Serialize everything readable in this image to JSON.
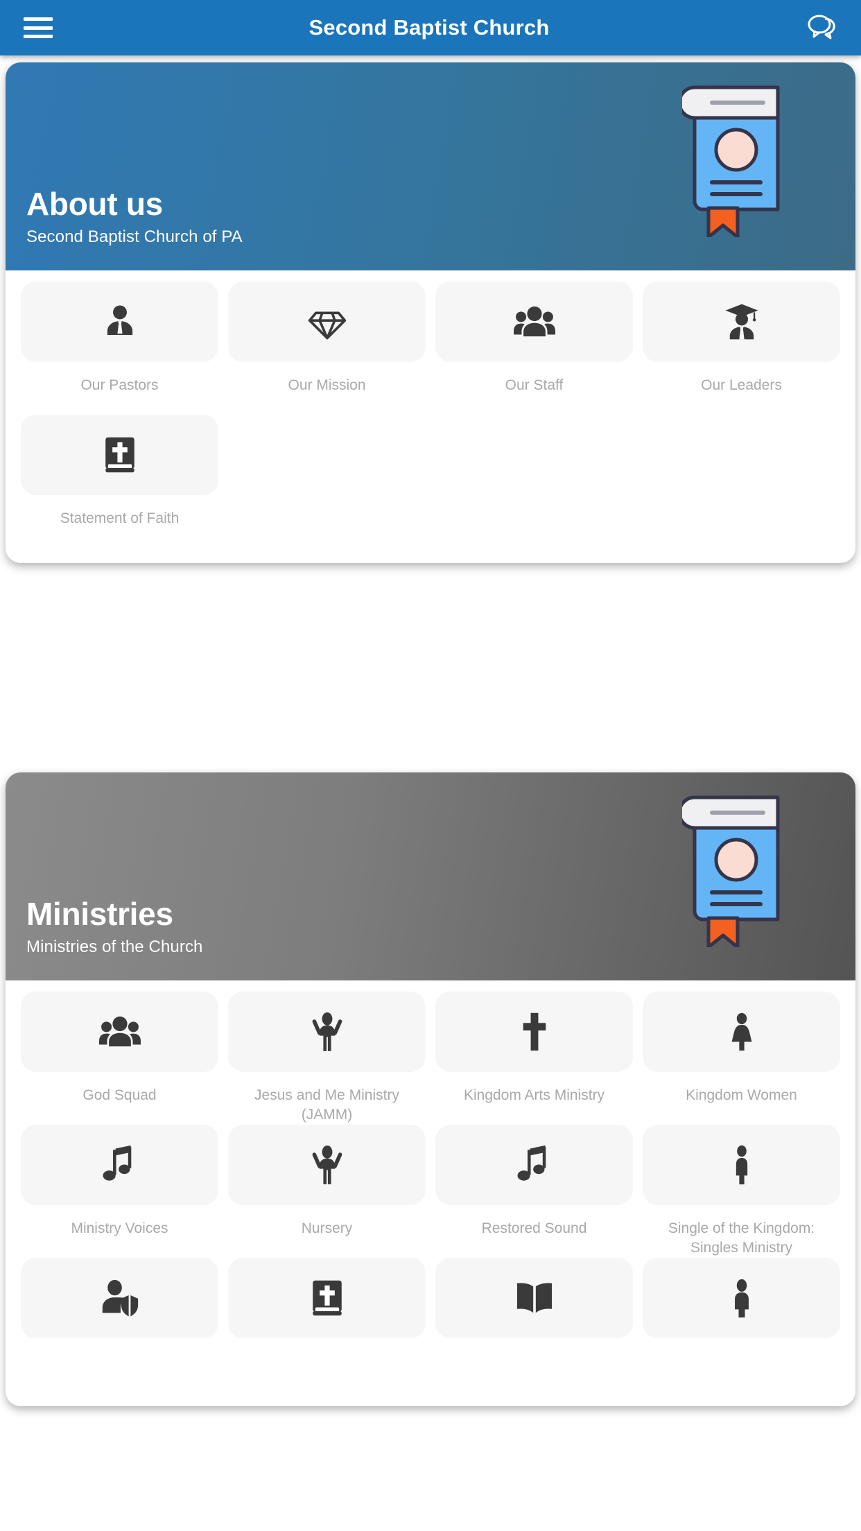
{
  "appbar": {
    "menu_icon": "hamburger-menu-icon",
    "title": "Second Baptist Church",
    "chat_icon": "chat-bubbles-icon"
  },
  "sections": [
    {
      "id": "about",
      "theme": "blue",
      "title": "About us",
      "subtitle": "Second Baptist Church of PA",
      "art_icon": "book-illustration",
      "tiles": [
        {
          "label": "Our Pastors",
          "icon": "person-in-tie-icon"
        },
        {
          "label": "Our Mission",
          "icon": "diamond-gem-icon"
        },
        {
          "label": "Our Staff",
          "icon": "people-group-icon"
        },
        {
          "label": "Our Leaders",
          "icon": "graduate-person-icon"
        },
        {
          "label": "Statement of Faith",
          "icon": "bible-cross-icon"
        }
      ]
    },
    {
      "id": "ministries",
      "theme": "gray",
      "title": "Ministries",
      "subtitle": "Ministries of the Church",
      "art_icon": "book-illustration",
      "tiles": [
        {
          "label": "God Squad",
          "icon": "people-group-icon"
        },
        {
          "label": "Jesus and Me Ministry\n(JAMM)",
          "icon": "person-arms-raised-icon"
        },
        {
          "label": "Kingdom Arts Ministry",
          "icon": "cross-icon"
        },
        {
          "label": "Kingdom Women",
          "icon": "woman-figure-icon"
        },
        {
          "label": "Ministry Voices",
          "icon": "music-note-icon"
        },
        {
          "label": "Nursery",
          "icon": "person-arms-raised-icon"
        },
        {
          "label": "Restored Sound",
          "icon": "music-note-icon"
        },
        {
          "label": "Single of the Kingdom:\nSingles Ministry",
          "icon": "single-person-icon"
        },
        {
          "label": "",
          "icon": "person-shield-icon"
        },
        {
          "label": "",
          "icon": "bible-cross-icon"
        },
        {
          "label": "",
          "icon": "open-book-icon"
        },
        {
          "label": "",
          "icon": "person-figure-icon"
        }
      ]
    }
  ],
  "colors": {
    "appbar": "#1b75bb",
    "hero_blue_start": "#3079b4",
    "hero_blue_end": "#3c6b86",
    "hero_gray_start": "#8b8b8b",
    "hero_gray_end": "#545454",
    "tile_bg": "#f6f6f6",
    "icon": "#3a3a3a",
    "label": "#a9a9a9",
    "book_cover": "#64b5f6",
    "book_page": "#f0f0f2",
    "book_circle": "#fadcd2",
    "bookmark": "#f4601f"
  }
}
